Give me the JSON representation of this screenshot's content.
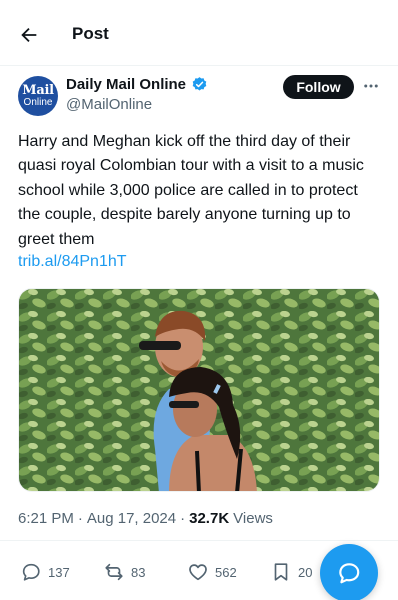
{
  "header": {
    "title": "Post",
    "back_icon": "arrow-left-icon"
  },
  "author": {
    "display_name": "Daily Mail Online",
    "handle": "@MailOnline",
    "avatar_line1": "Mail",
    "avatar_line2": "Online",
    "verified": true,
    "follow_label": "Follow"
  },
  "post": {
    "text": "Harry and Meghan kick off the third day of their quasi royal Colombian tour with a visit to a music school while 3,000 police are called in to protect the couple, despite barely anyone turning up to greet them",
    "link": "trib.al/84Pn1hT",
    "time": "6:21 PM",
    "separator": "·",
    "date": "Aug 17, 2024",
    "views_count": "32.7K",
    "views_label": "Views"
  },
  "actions": {
    "replies": "137",
    "reposts": "83",
    "likes": "562",
    "bookmarks": "20"
  },
  "colors": {
    "accent": "#1d9bf0",
    "text": "#0f1419",
    "secondary": "#536471",
    "avatar_bg": "#1f4fa0"
  }
}
